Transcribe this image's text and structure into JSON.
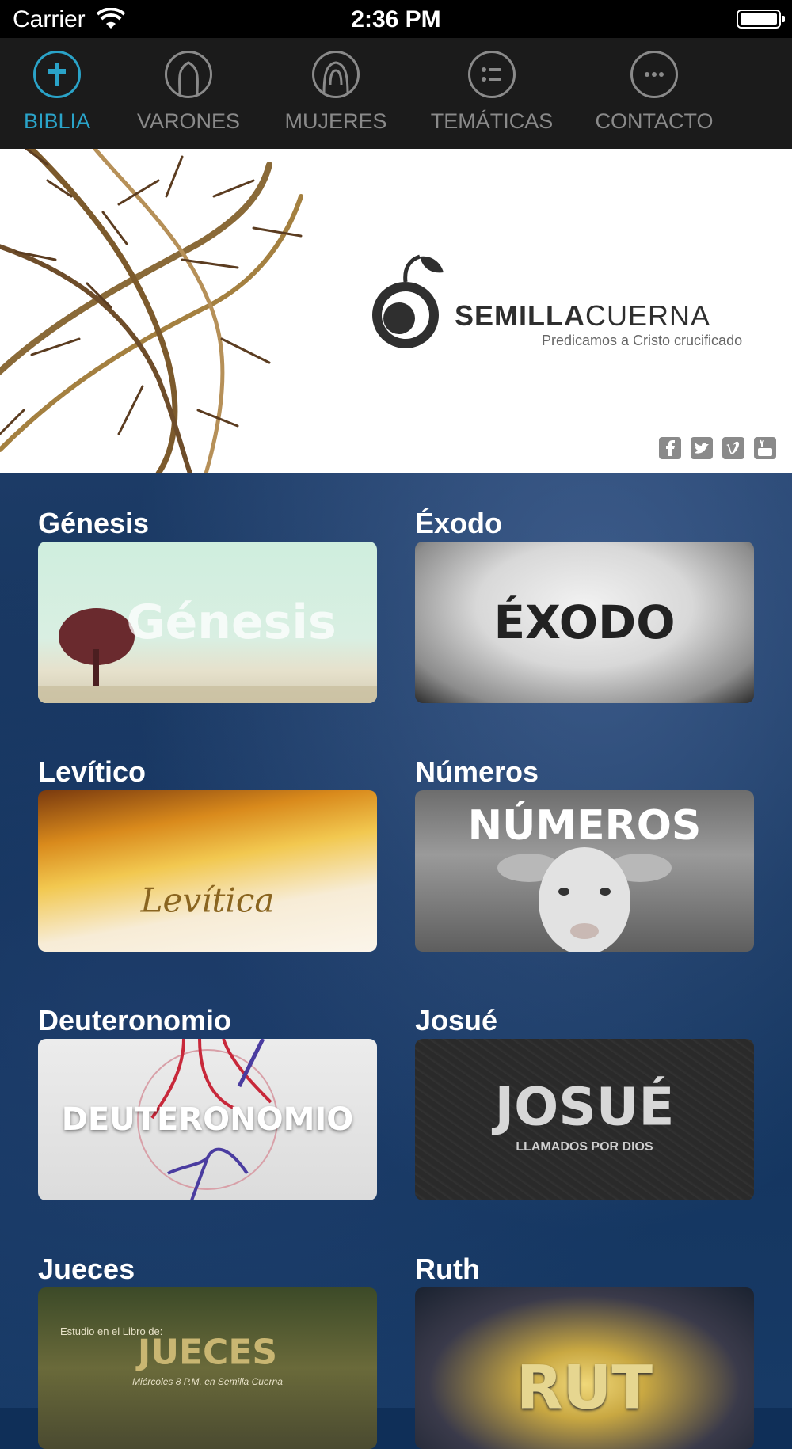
{
  "status_bar": {
    "carrier": "Carrier",
    "time": "2:36 PM"
  },
  "tabs": [
    {
      "label": "BIBLIA",
      "icon": "bible-cross-icon",
      "active": true
    },
    {
      "label": "VARONES",
      "icon": "man-icon",
      "active": false
    },
    {
      "label": "MUJERES",
      "icon": "woman-icon",
      "active": false
    },
    {
      "label": "TEMÁTICAS",
      "icon": "list-icon",
      "active": false
    },
    {
      "label": "CONTACTO",
      "icon": "chat-bubble-icon",
      "active": false
    }
  ],
  "banner": {
    "brand_bold": "SEMILLA",
    "brand_light": "CUERNA",
    "tagline": "Predicamos a Cristo crucificado",
    "social": [
      "facebook-icon",
      "twitter-icon",
      "vimeo-icon",
      "youtube-icon"
    ]
  },
  "books": [
    {
      "title": "Génesis",
      "image_text": "Génesis"
    },
    {
      "title": "Éxodo",
      "image_text": "ÉXODO"
    },
    {
      "title": "Levítico",
      "image_text": "Levítica"
    },
    {
      "title": "Números",
      "image_text": "NÚMEROS"
    },
    {
      "title": "Deuteronomio",
      "image_text": "DEUTERONOMIO"
    },
    {
      "title": "Josué",
      "image_text": "JOSUÉ",
      "image_subtext": "LLAMADOS POR DIOS"
    },
    {
      "title": "Jueces",
      "image_text": "JUECES",
      "image_pretext": "Estudio en el Libro de:",
      "image_subtext": "Miércoles 8 P.M. en Semilla Cuerna"
    },
    {
      "title": "Ruth",
      "image_text": "RUT"
    }
  ],
  "colors": {
    "active_tab": "#2aa3c8",
    "inactive_tab": "#8a8a8a",
    "tabbar_bg": "#1b1b1b"
  }
}
